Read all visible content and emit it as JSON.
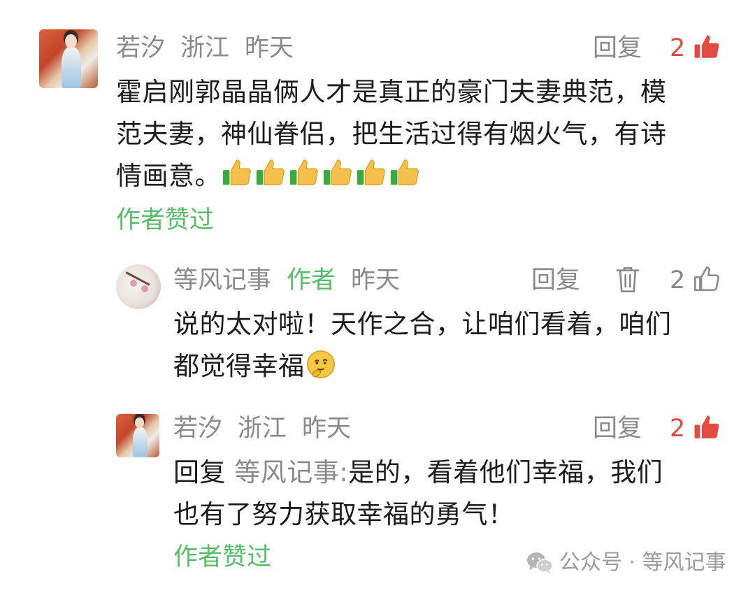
{
  "comments": [
    {
      "user": "若汐",
      "location": "浙江",
      "time": "昨天",
      "reply_label": "回复",
      "like_count": "2",
      "text_lines": [
        "霍启刚郭晶晶俩人才是真正的豪门夫妻典范，模",
        "范夫妻，神仙眷侣，把生活过得有烟火气，有诗",
        "情画意。"
      ],
      "liked_by_author": "作者赞过",
      "emoji": "thumbs-up-icon"
    },
    {
      "user": "等风记事",
      "author_tag": "作者",
      "time": "昨天",
      "reply_label": "回复",
      "like_count": "2",
      "text_lines": [
        "说的太对啦！天作之合，让咱们看着，咱们",
        "都觉得幸福"
      ],
      "emoji": "thinking-face-icon"
    },
    {
      "user": "若汐",
      "location": "浙江",
      "time": "昨天",
      "reply_label": "回复",
      "like_count": "2",
      "reply_prefix": "回复",
      "reply_target": "等风记事:",
      "text_lines": [
        "是的，看着他们幸福，我们",
        "也有了努力获取幸福的勇气！"
      ],
      "liked_by_author": "作者赞过"
    }
  ],
  "footer": {
    "label": "公众号 · 等风记事",
    "icon": "wechat-icon"
  },
  "colors": {
    "green": "#58be6a",
    "red": "#e24a42",
    "grey": "#8a8a8a"
  }
}
